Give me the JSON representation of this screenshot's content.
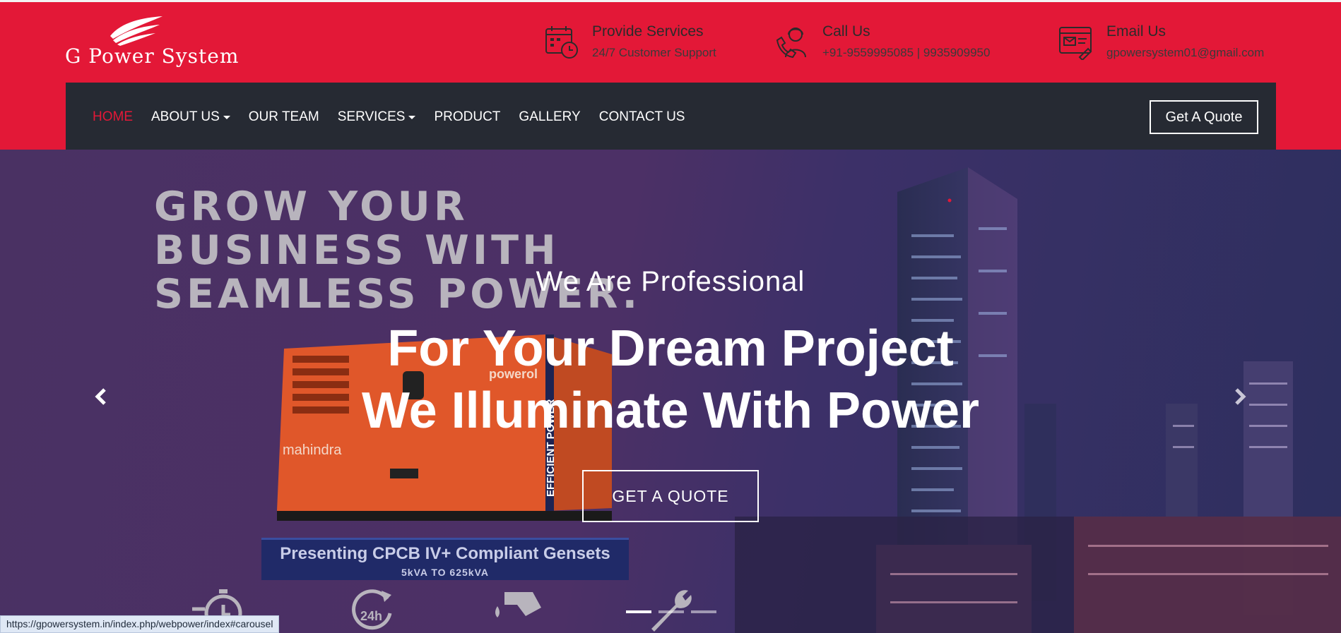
{
  "brand": {
    "name": "G Power System"
  },
  "header_info": [
    {
      "icon": "calendar-clock-icon",
      "title": "Provide Services",
      "subtitle": "24/7 Customer Support"
    },
    {
      "icon": "support-agent-phone-icon",
      "title": "Call Us",
      "subtitle": "+91-9559995085 | 9935909950"
    },
    {
      "icon": "email-browser-icon",
      "title": "Email Us",
      "subtitle": "gpowersystem01@gmail.com"
    }
  ],
  "nav": {
    "items": [
      {
        "label": "HOME",
        "active": true,
        "dropdown": false
      },
      {
        "label": "ABOUT US",
        "active": false,
        "dropdown": true
      },
      {
        "label": "OUR TEAM",
        "active": false,
        "dropdown": false
      },
      {
        "label": "SERVICES",
        "active": false,
        "dropdown": true
      },
      {
        "label": "PRODUCT",
        "active": false,
        "dropdown": false
      },
      {
        "label": "GALLERY",
        "active": false,
        "dropdown": false
      },
      {
        "label": "CONTACT US",
        "active": false,
        "dropdown": false
      }
    ],
    "quote_label": "Get A Quote"
  },
  "hero": {
    "promo_heading": [
      "GROW YOUR",
      "BUSINESS WITH",
      "SEAMLESS POWER."
    ],
    "genset_brand": "mahindra",
    "genset_badge": "powerol",
    "genset_side_text": "EFFICIENT POWER",
    "promo_banner_line1": "Presenting CPCB IV+ Compliant Gensets",
    "promo_banner_line2": "5kVA TO 625kVA",
    "subtitle": "We Are Professional",
    "title_line1": "For Your Dream Project",
    "title_line2": "We Illuminate With Power",
    "cta_label": "GET A QUOTE",
    "feature_icon_24h": "24h",
    "slide_count": 3,
    "active_slide": 0
  },
  "status_bar": {
    "url": "https://gpowersystem.in/index.php/webpower/index#carousel"
  },
  "colors": {
    "brand_red": "#e31837",
    "nav_dark": "#262a33",
    "hero_purple": "#4a3163"
  }
}
